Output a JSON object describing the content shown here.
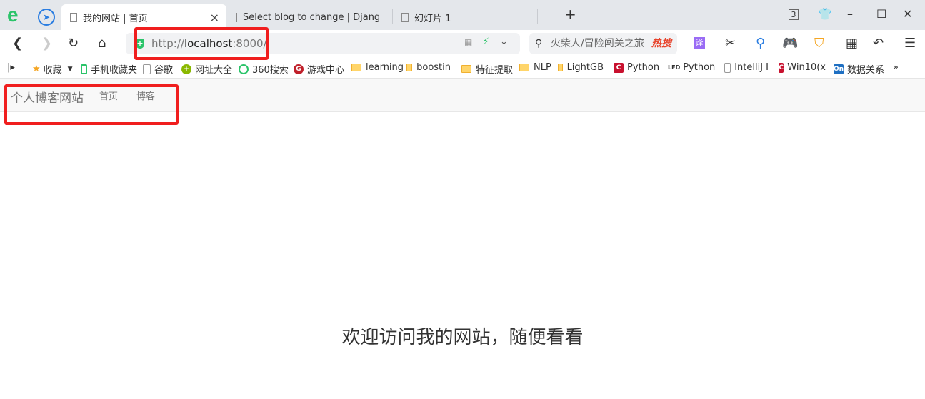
{
  "tabs": [
    {
      "label": "我的网站 | 首页",
      "active": true
    },
    {
      "label": "Select blog to change | Djang"
    },
    {
      "label": "幻灯片 1"
    }
  ],
  "window": {
    "tab_count": "3"
  },
  "address": {
    "scheme": "http://",
    "host": "localhost",
    "port": ":8000/"
  },
  "search": {
    "placeholder": "火柴人/冒险闯关之旅",
    "hot": "热搜"
  },
  "bookmarks": [
    "收藏",
    "手机收藏夹",
    "谷歌",
    "网址大全",
    "360搜索",
    "游戏中心",
    "learning",
    "boostin",
    "特征提取",
    "NLP",
    "LightGB",
    "Python",
    "Python",
    "IntelliJ I",
    "Win10(x",
    "数据关系"
  ],
  "toolbar": {
    "translate": "译",
    "more": "»"
  },
  "site": {
    "brand": "个人博客网站",
    "nav": [
      "首页",
      "博客"
    ],
    "welcome": "欢迎访问我的网站，随便看看"
  },
  "colors": {
    "highlight": "#f01e1e",
    "accent": "#2bc46a"
  }
}
